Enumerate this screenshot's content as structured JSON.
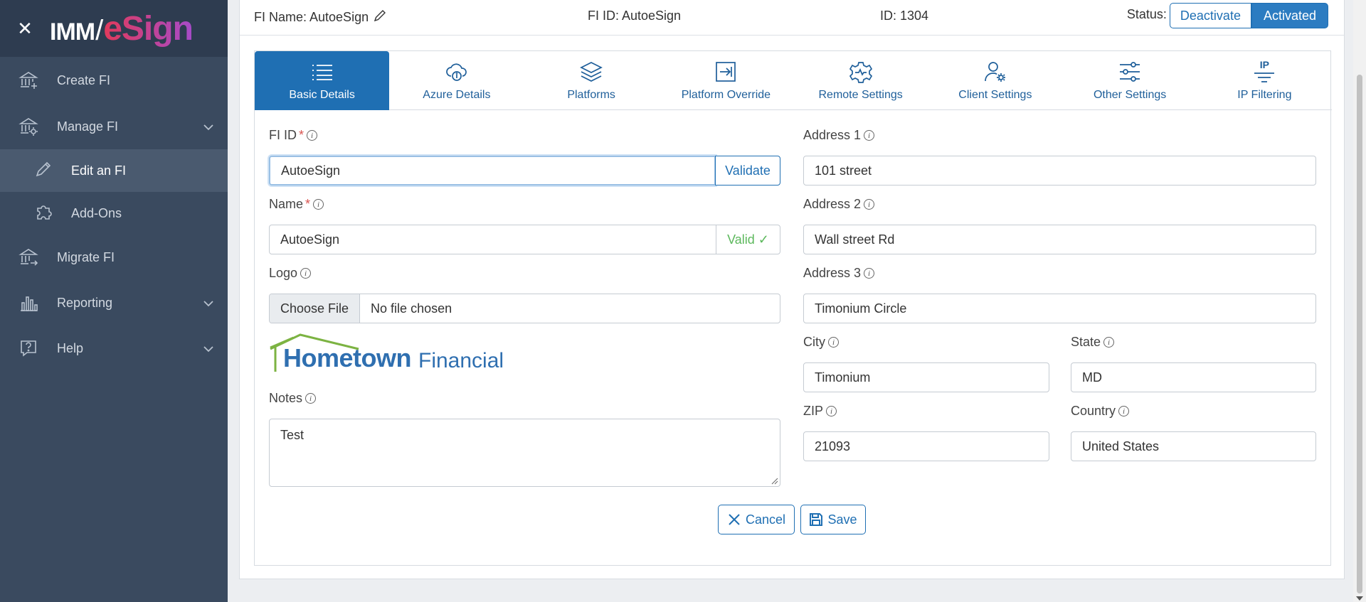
{
  "sidebar": {
    "logo_imm": "IMM",
    "logo_slash": "/",
    "logo_esign": "eSign",
    "items": [
      {
        "label": "Create FI",
        "icon": "bank-plus-icon"
      },
      {
        "label": "Manage FI",
        "icon": "bank-gear-icon",
        "expandable": true
      },
      {
        "label": "Edit an FI",
        "icon": "pencil-icon",
        "sub": true,
        "active": true
      },
      {
        "label": "Add-Ons",
        "icon": "puzzle-icon",
        "sub": true
      },
      {
        "label": "Migrate FI",
        "icon": "bank-arrow-icon"
      },
      {
        "label": "Reporting",
        "icon": "bar-chart-icon",
        "expandable": true
      },
      {
        "label": "Help",
        "icon": "question-bubble-icon",
        "expandable": true
      }
    ]
  },
  "topbar": {
    "fi_name": "FI Name: AutoeSign",
    "fi_id": "FI ID: AutoeSign",
    "id": "ID: 1304",
    "status_label": "Status:",
    "deactivate": "Deactivate",
    "activated": "Activated"
  },
  "tabs": [
    {
      "label": "Basic Details",
      "icon": "list-icon",
      "active": true
    },
    {
      "label": "Azure Details",
      "icon": "cloud-icon"
    },
    {
      "label": "Platforms",
      "icon": "layers-icon"
    },
    {
      "label": "Platform Override",
      "icon": "arrow-in-box-icon"
    },
    {
      "label": "Remote Settings",
      "icon": "gear-pulse-icon"
    },
    {
      "label": "Client Settings",
      "icon": "user-gear-icon"
    },
    {
      "label": "Other Settings",
      "icon": "sliders-icon"
    },
    {
      "label": "IP Filtering",
      "icon": "filter-icon",
      "icon_text": "IP"
    }
  ],
  "form": {
    "fi_id": {
      "label": "FI ID",
      "value": "AutoeSign",
      "addon": "Validate"
    },
    "name": {
      "label": "Name",
      "value": "AutoeSign",
      "addon": "Valid ✓"
    },
    "logo": {
      "label": "Logo",
      "choose": "Choose File",
      "file": "No file chosen",
      "brand": "Hometown",
      "brand_suffix": "Financial"
    },
    "notes": {
      "label": "Notes",
      "value": "Test"
    },
    "address1": {
      "label": "Address 1",
      "value": "101 street"
    },
    "address2": {
      "label": "Address 2",
      "value": "Wall street Rd"
    },
    "address3": {
      "label": "Address 3",
      "value": "Timonium Circle"
    },
    "city": {
      "label": "City",
      "value": "Timonium"
    },
    "state": {
      "label": "State",
      "value": "MD"
    },
    "zip": {
      "label": "ZIP",
      "value": "21093"
    },
    "country": {
      "label": "Country",
      "value": "United States"
    },
    "required_mark": "*",
    "info_mark": "i"
  },
  "actions": {
    "cancel": "Cancel",
    "save": "Save"
  },
  "colors": {
    "sidebar": "#3a4a5f",
    "accent": "#1f6fb3",
    "valid": "#5cb85c",
    "required": "#d9534f"
  }
}
